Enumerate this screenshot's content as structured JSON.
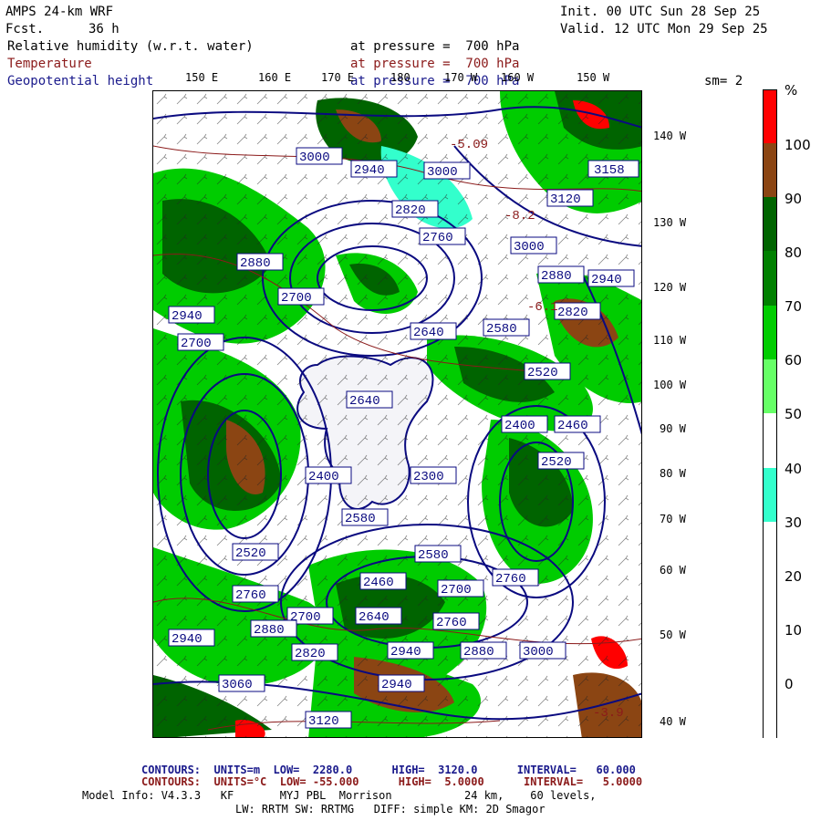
{
  "header": {
    "model": "AMPS 24-km WRF",
    "fcst_label": "Fcst.",
    "fcst_value": "36 h",
    "init": "Init. 00 UTC Sun 28 Sep 25",
    "valid": "Valid. 12 UTC Mon 29 Sep 25",
    "var_rh": "Relative humidity (w.r.t. water)",
    "var_t": "Temperature",
    "var_z": "Geopotential height",
    "pressure_rh": "at pressure =  700 hPa",
    "pressure_t": "at pressure =  700 hPa",
    "pressure_z": "at pressure =  700 hPa",
    "smoothing": "sm= 2"
  },
  "lon_labels": [
    "150 E",
    "160 E",
    "170 E",
    "180",
    "170 W",
    "160 W",
    "150 W"
  ],
  "lat_labels": [
    "140 W",
    "130 W",
    "120 W",
    "110 W",
    "100 W",
    "90 W",
    "80 W",
    "70 W",
    "60 W",
    "50 W",
    "40 W"
  ],
  "colorbar": {
    "unit": "%",
    "labels": [
      "100",
      "90",
      "80",
      "70",
      "60",
      "50",
      "40",
      "30",
      "20",
      "10",
      "0"
    ],
    "colors": [
      "#ff0000",
      "#8b4513",
      "#006400",
      "#008000",
      "#00cc00",
      "#66ff66",
      "#33ffcc",
      "#ffffff",
      "#ffffff",
      "#ffffff",
      "#ffffff"
    ]
  },
  "height_labels": [
    "3000",
    "2940",
    "3000",
    "3158",
    "3120",
    "2880",
    "2820",
    "2760",
    "3000",
    "2880",
    "2940",
    "2940",
    "2820",
    "2700",
    "2640",
    "2580",
    "2520",
    "2460",
    "2400",
    "2700",
    "2640",
    "2580",
    "2520",
    "2760",
    "2700",
    "2640",
    "2580",
    "2700",
    "2760",
    "2880",
    "2940",
    "3000",
    "3060",
    "3120",
    "2940",
    "2820",
    "2640",
    "2580",
    "2520",
    "2460",
    "2400",
    "2300",
    "2820",
    "2760",
    "3060",
    "2940",
    "2880"
  ],
  "temp_labels": [
    "-5.09",
    "-8.2",
    "-3.9",
    "-6.1"
  ],
  "footer": {
    "z_contours": "CONTOURS:  UNITS=m  LOW=  2280.0      HIGH=  3120.0      INTERVAL=   60.000",
    "t_contours": "CONTOURS:  UNITS=°C  LOW= -55.000      HIGH=  5.0000      INTERVAL=   5.0000",
    "model_info": "Model Info: V4.3.3   KF       MYJ PBL  Morrison           24 km,    60 levels,",
    "model_info2": "LW: RRTM SW: RRTMG   DIFF: simple KM: 2D Smagor"
  }
}
